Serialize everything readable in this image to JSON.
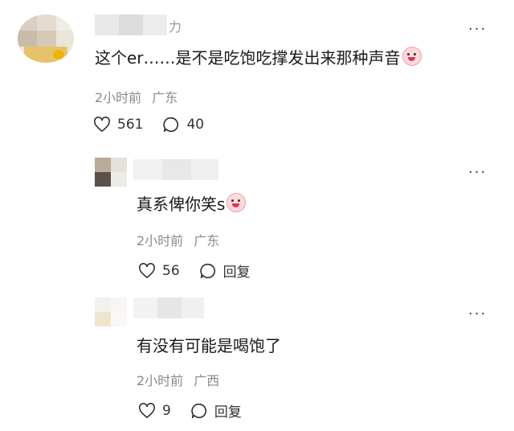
{
  "comments": [
    {
      "username_partial": "力",
      "text": "这个er……是不是吃饱吃撑发出来那种声音",
      "time": "2小时前",
      "location": "广东",
      "likes": "561",
      "replies": "40"
    },
    {
      "text": "真系俾你笑s",
      "time": "2小时前",
      "location": "广东",
      "likes": "56",
      "reply_label": "回复"
    },
    {
      "text": "有没有可能是喝饱了",
      "time": "2小时前",
      "location": "广西",
      "likes": "9",
      "reply_label": "回复"
    }
  ],
  "more_label": "···",
  "icons": [
    "heart-icon",
    "comment-icon",
    "emoji-icon",
    "more-icon"
  ]
}
